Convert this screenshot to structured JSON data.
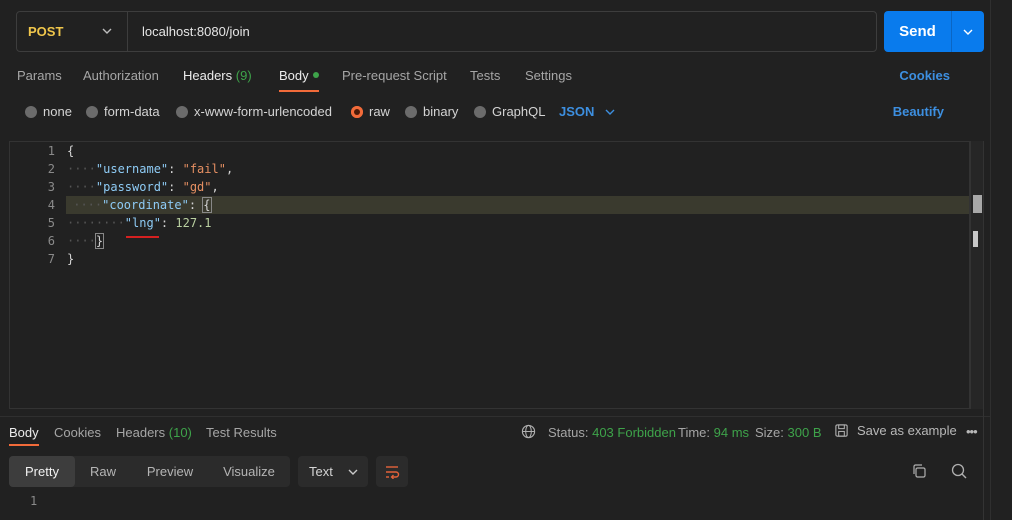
{
  "request": {
    "method": "POST",
    "url": "localhost:8080/join",
    "send_label": "Send"
  },
  "tabs": {
    "params": "Params",
    "authorization": "Authorization",
    "headers": "Headers",
    "headers_count": "(9)",
    "body": "Body",
    "pre_request": "Pre-request Script",
    "tests": "Tests",
    "settings": "Settings",
    "cookies": "Cookies"
  },
  "body_types": {
    "none": "none",
    "form_data": "form-data",
    "urlencoded": "x-www-form-urlencoded",
    "raw": "raw",
    "binary": "binary",
    "graphql": "GraphQL",
    "format": "JSON",
    "selected": "raw",
    "beautify": "Beautify"
  },
  "editor": {
    "line_numbers": [
      "1",
      "2",
      "3",
      "4",
      "5",
      "6",
      "7"
    ],
    "lines": {
      "l1_open": "{",
      "l2_key": "\"username\"",
      "l2_val": "\"fail\"",
      "l3_key": "\"password\"",
      "l3_val": "\"gd\"",
      "l4_key": "\"coordinate\"",
      "l4_open": "{",
      "l5_key": "\"lng\"",
      "l5_val": "127.1",
      "l6_close": "}",
      "l7_close": "}"
    }
  },
  "response": {
    "tabs": {
      "body": "Body",
      "cookies": "Cookies",
      "headers": "Headers",
      "headers_count": "(10)",
      "test_results": "Test Results"
    },
    "status_label": "Status:",
    "status_value": "403 Forbidden",
    "time_label": "Time:",
    "time_value": "94 ms",
    "size_label": "Size:",
    "size_value": "300 B",
    "save_example": "Save as example",
    "more": "•••",
    "views": {
      "pretty": "Pretty",
      "raw": "Raw",
      "preview": "Preview",
      "visualize": "Visualize"
    },
    "format": "Text",
    "line_numbers": [
      "1"
    ]
  },
  "icons": {
    "method_chevron": "chevron-down-icon",
    "send_chevron": "chevron-down-icon",
    "globe": "globe-icon",
    "save": "save-icon",
    "wrap": "wrap-lines-icon",
    "copy": "copy-icon",
    "search": "search-icon"
  },
  "colors": {
    "accent_blue": "#097bed",
    "link_blue": "#3d8fe0",
    "method_yellow": "#f0c64b",
    "active_orange": "#f26b3a",
    "status_green": "#3ea34a",
    "error_red": "#d42020"
  }
}
